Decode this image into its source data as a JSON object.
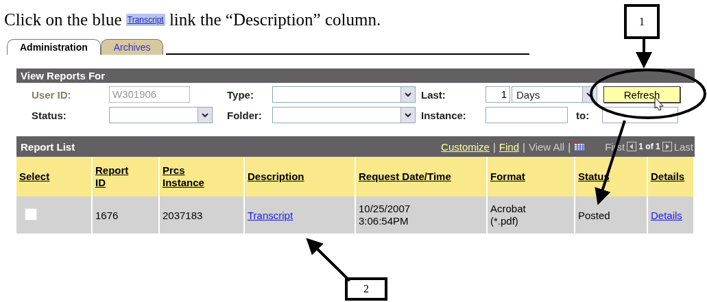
{
  "instruction": {
    "before": "Click on the blue",
    "link": "Transcript",
    "after": "link the “Description” column."
  },
  "tabs": [
    {
      "label": "Administration",
      "selected": true
    },
    {
      "label": "Archives",
      "selected": false
    }
  ],
  "filters": {
    "title": "View Reports For",
    "user_id": {
      "label": "User ID:",
      "value": "W301906",
      "disabled": true
    },
    "type": {
      "label": "Type:"
    },
    "last": {
      "label": "Last:",
      "value": "1",
      "unit": "Days"
    },
    "refresh_button": "Refresh",
    "status": {
      "label": "Status:"
    },
    "folder": {
      "label": "Folder:"
    },
    "instance": {
      "label": "Instance:"
    },
    "to": {
      "label": "to:"
    }
  },
  "report_list": {
    "title": "Report List",
    "links": [
      "Customize",
      "Find"
    ],
    "view_all": "View All",
    "separator": "|",
    "first": "First",
    "page_info": "1 of 1",
    "last": "Last",
    "columns": [
      "Select",
      "Report ID",
      "Prcs Instance",
      "Description",
      "Request Date/Time",
      "Format",
      "Status",
      "Details"
    ],
    "rows": [
      {
        "checked": false,
        "report_id": "1676",
        "prcs_instance": "2037183",
        "description": "Transcript",
        "request_date": "10/25/2007",
        "request_time": "3:06:54PM",
        "format": "Acrobat",
        "format_ext": "(*.pdf)",
        "status": "Posted",
        "details": "Details"
      }
    ]
  },
  "callouts": [
    "1",
    "2"
  ]
}
